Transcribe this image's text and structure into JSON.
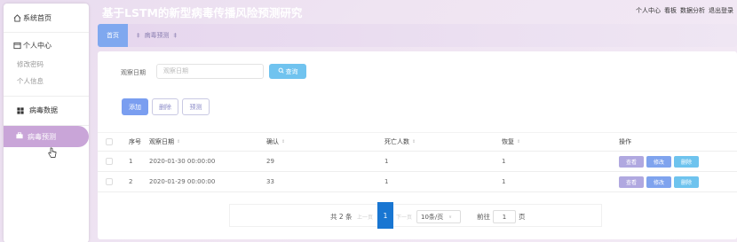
{
  "app": {
    "title": "基于LSTM的新型病毒传播风险预测研究"
  },
  "header": {
    "links": [
      "个人中心",
      "看板",
      "数据分析",
      "退出登录"
    ]
  },
  "sidebar": {
    "home": "系统首页",
    "personal_center": "个人中心",
    "change_password": "修改密码",
    "personal_info": "个人信息",
    "virus_data": "病毒数据",
    "virus_forecast": "病毒预测"
  },
  "tabs": {
    "home": "首页",
    "forecast": "病毒预测"
  },
  "search": {
    "label": "观察日期",
    "placeholder": "观察日期",
    "button": "查询"
  },
  "actions": {
    "add": "添加",
    "delete": "删除",
    "predict": "预测"
  },
  "table": {
    "headers": [
      "序号",
      "观察日期",
      "确认",
      "死亡人数",
      "恢复",
      "操作"
    ],
    "rows": [
      {
        "index": "1",
        "date": "2020-01-30 00:00:00",
        "confirmed": "29",
        "deaths": "1",
        "recovered": "1"
      },
      {
        "index": "2",
        "date": "2020-01-29 00:00:00",
        "confirmed": "33",
        "deaths": "1",
        "recovered": "1"
      }
    ],
    "row_actions": {
      "view": "查看",
      "edit": "修改",
      "delete": "删除"
    }
  },
  "pagination": {
    "total": "共 2 条",
    "prev": "上一页",
    "current": "1",
    "next": "下一页",
    "page_size": "10条/页",
    "goto": "前往",
    "goto_value": "1",
    "page_unit": "页"
  },
  "colors": {
    "accent_blue": "#7a9ef0",
    "search_btn": "#70c3ef",
    "sidebar_active": "#c9a5d8",
    "view_btn": "#b0a8e0",
    "edit_btn": "#7fa3ee",
    "delete_btn": "#6ec3ee"
  }
}
